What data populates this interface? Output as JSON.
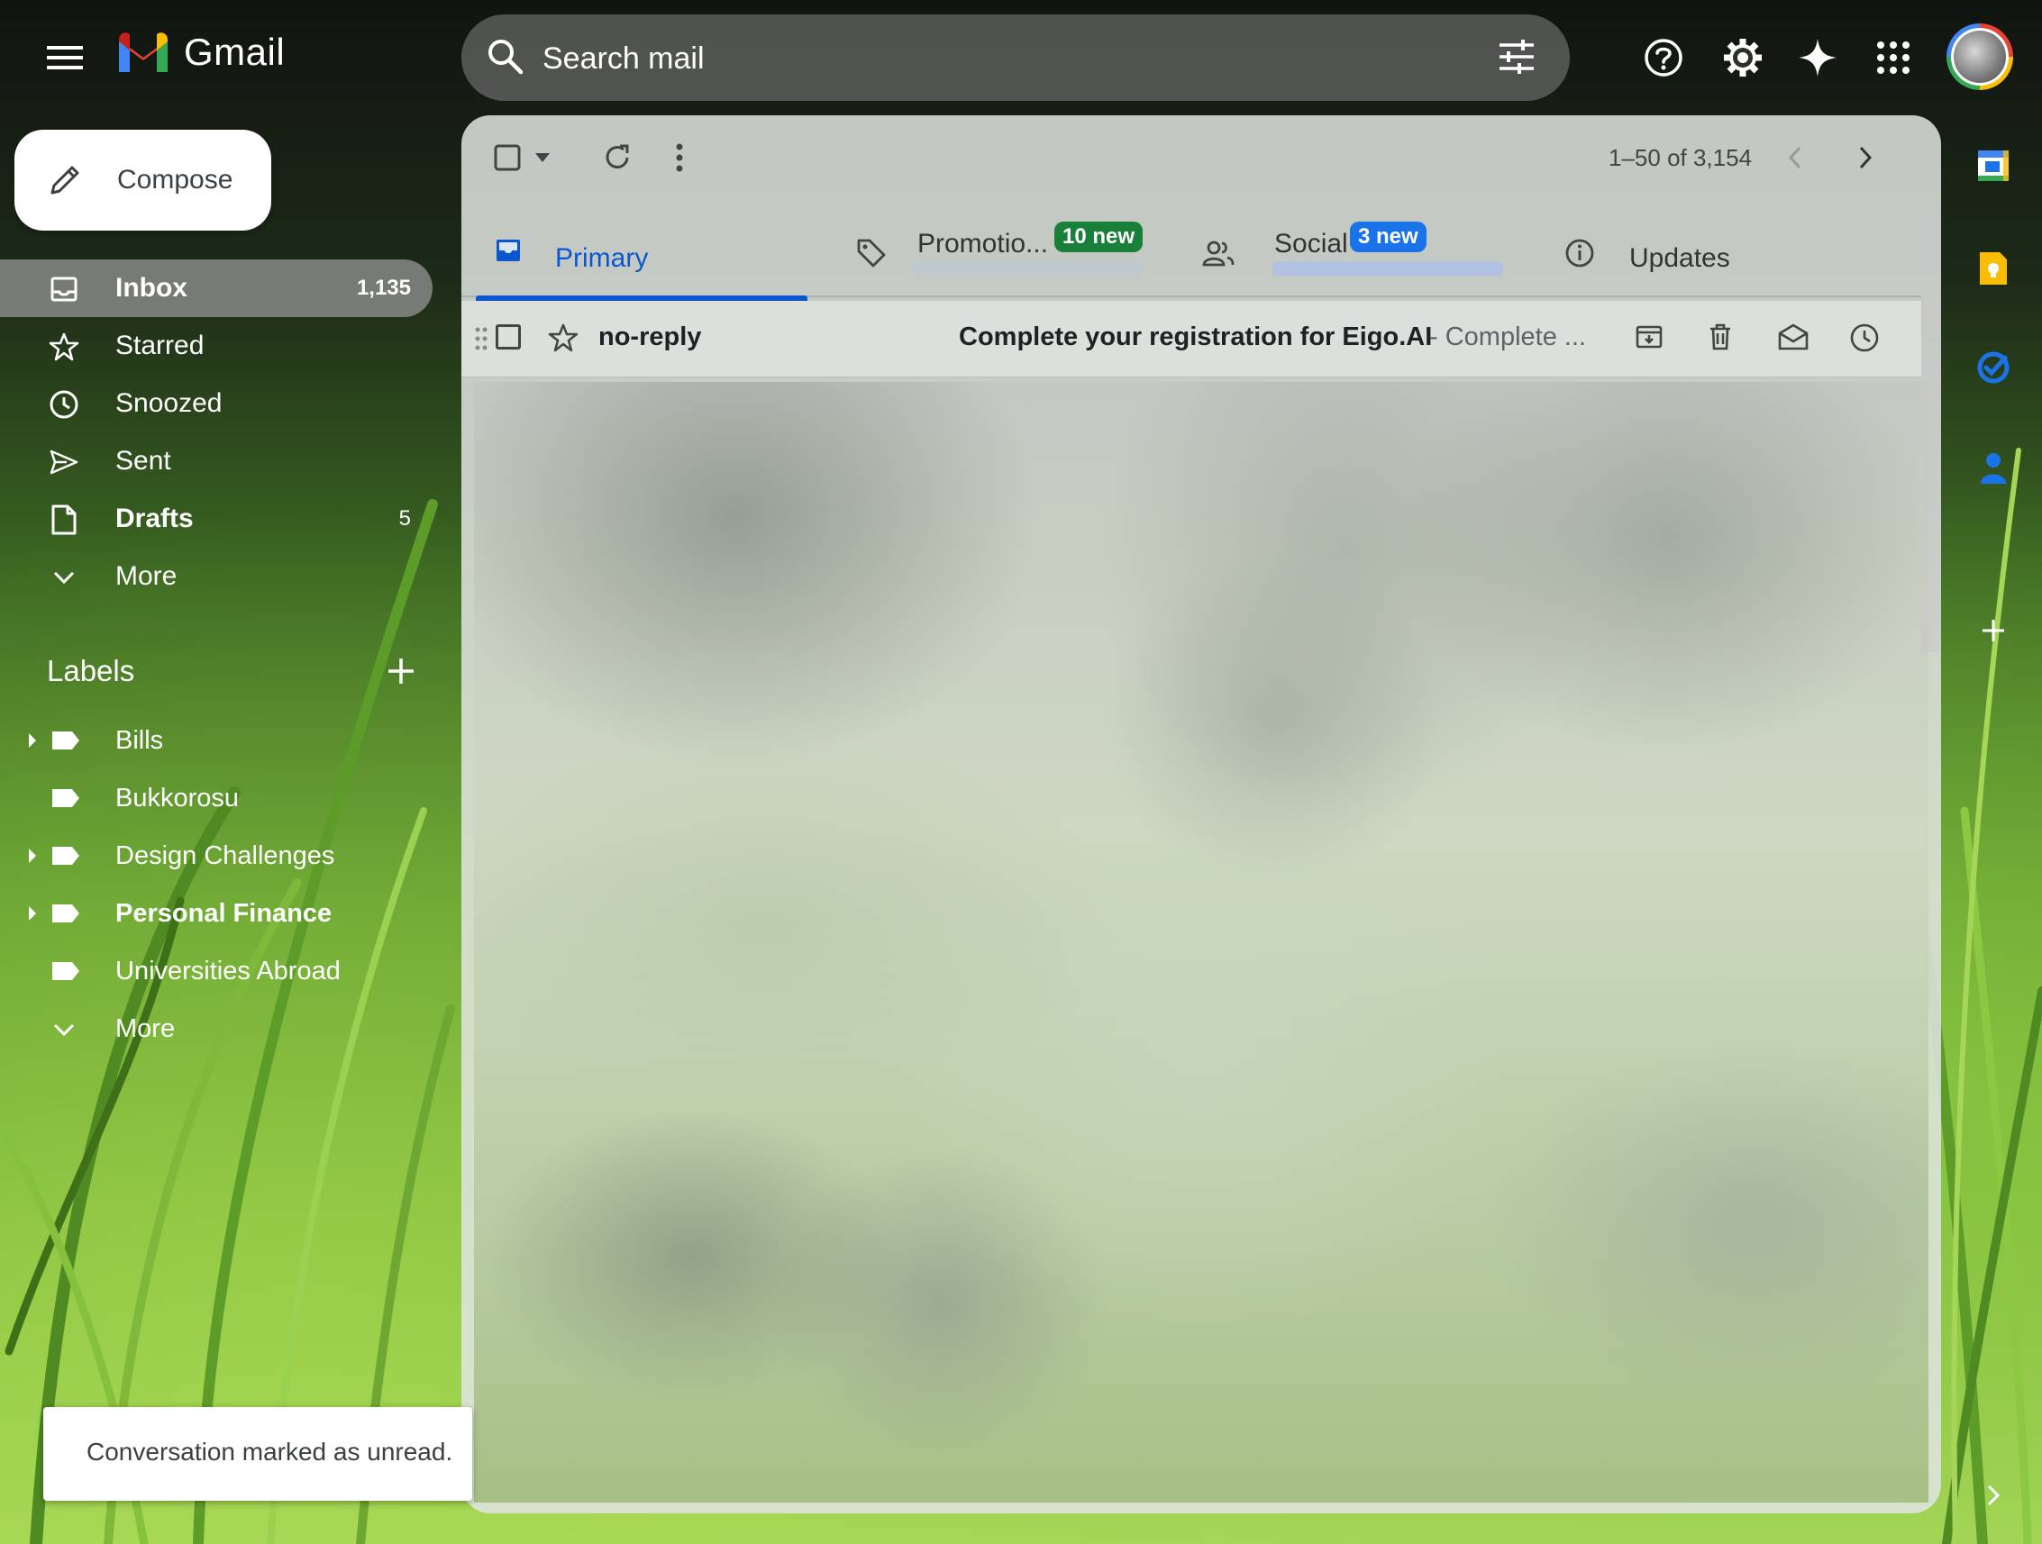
{
  "app": {
    "name": "Gmail"
  },
  "search": {
    "placeholder": "Search mail"
  },
  "compose": {
    "label": "Compose"
  },
  "nav": [
    {
      "label": "Inbox",
      "count": "1,135",
      "icon": "inbox-icon",
      "active": true,
      "bold": true
    },
    {
      "label": "Starred",
      "count": "",
      "icon": "star-icon"
    },
    {
      "label": "Snoozed",
      "count": "",
      "icon": "clock-icon"
    },
    {
      "label": "Sent",
      "count": "",
      "icon": "send-icon"
    },
    {
      "label": "Drafts",
      "count": "5",
      "icon": "draft-icon",
      "bold": true
    },
    {
      "label": "More",
      "count": "",
      "icon": "chevron-down-icon"
    }
  ],
  "labels": {
    "heading": "Labels",
    "items": [
      {
        "label": "Bills",
        "expandable": true
      },
      {
        "label": "Bukkorosu",
        "expandable": false
      },
      {
        "label": "Design Challenges",
        "expandable": true
      },
      {
        "label": "Personal Finance",
        "expandable": true,
        "bold": true
      },
      {
        "label": "Universities Abroad",
        "expandable": false
      }
    ],
    "more": "More"
  },
  "toolbar": {
    "pagination": "1–50 of 3,154"
  },
  "tabs": [
    {
      "label": "Primary",
      "icon": "inbox-icon",
      "active": true
    },
    {
      "label": "Promotio...",
      "badge": "10 new",
      "icon": "tag-icon"
    },
    {
      "label": "Social",
      "badge": "3 new",
      "icon": "people-icon"
    },
    {
      "label": "Updates",
      "icon": "info-icon"
    }
  ],
  "email_row": {
    "sender": "no-reply",
    "subject": "Complete your registration for Eigo.AI",
    "snippet": " - Complete ..."
  },
  "snackbar": {
    "text": "Conversation marked as unread."
  },
  "colors": {
    "accent": "#0b57d0",
    "promo_badge": "#188038",
    "social_badge": "#1a73e8"
  }
}
